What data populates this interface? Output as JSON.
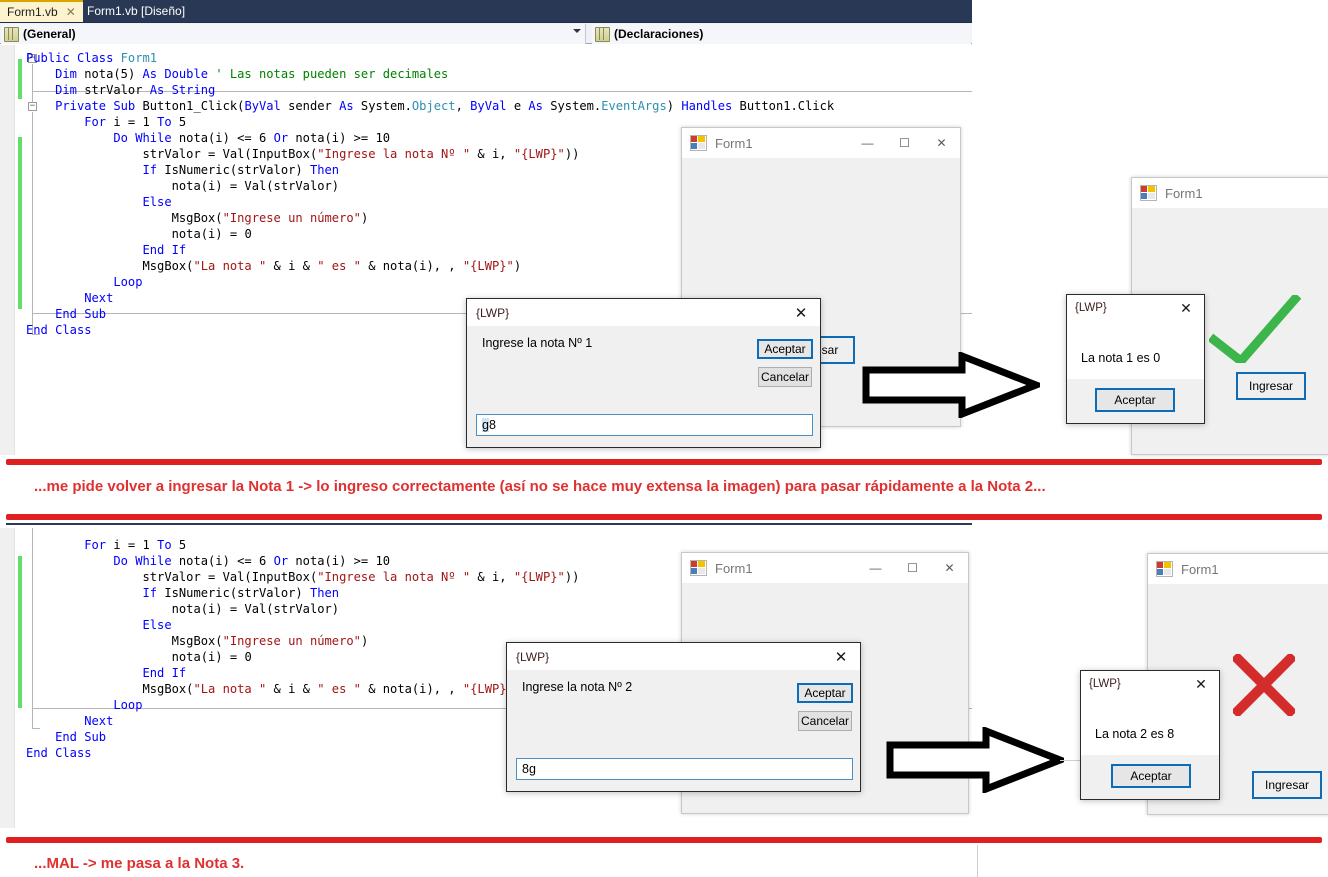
{
  "ide": {
    "tabs": [
      {
        "label": "Form1.vb",
        "active": true,
        "close_glyph": "✕"
      },
      {
        "label": "Form1.vb [Diseño]",
        "active": false
      }
    ],
    "nav": {
      "scope": "(General)",
      "member": "(Declaraciones)",
      "dropdown_glyph": "▼"
    },
    "code_top": [
      "Public Class Form1",
      "    Dim nota(5) As Double ' Las notas pueden ser decimales",
      "    Dim strValor As String",
      "    Private Sub Button1_Click(ByVal sender As System.Object, ByVal e As System.EventArgs) Handles Button1.Click",
      "        For i = 1 To 5",
      "            Do While nota(i) <= 6 Or nota(i) >= 10",
      "                strValor = Val(InputBox(\"Ingrese la nota Nº \" & i, \"{LWP}\"))",
      "                If IsNumeric(strValor) Then",
      "                    nota(i) = Val(strValor)",
      "                Else",
      "                    MsgBox(\"Ingrese un número\")",
      "                    nota(i) = 0",
      "                End If",
      "                MsgBox(\"La nota \" & i & \" es \" & nota(i), , \"{LWP}\")",
      "            Loop",
      "        Next",
      "    End Sub",
      "End Class"
    ],
    "code_bottom": [
      "        For i = 1 To 5",
      "            Do While nota(i) <= 6 Or nota(i) >= 10",
      "                strValor = Val(InputBox(\"Ingrese la nota Nº \" & i, \"{LWP}\"))",
      "                If IsNumeric(strValor) Then",
      "                    nota(i) = Val(strValor)",
      "                Else",
      "                    MsgBox(\"Ingrese un número\")",
      "                    nota(i) = 0",
      "                End If",
      "                MsgBox(\"La nota \" & i & \" es \" & nota(i), , \"{LWP}\")",
      "            Loop",
      "        Next",
      "    End Sub",
      "End Class"
    ]
  },
  "section_top": {
    "form_window": {
      "title": "Form1",
      "minimize_glyph": "—",
      "maximize_glyph": "☐",
      "close_glyph": "✕",
      "button_label": "sar"
    },
    "inputbox": {
      "title": "{LWP}",
      "close_glyph": "✕",
      "prompt": "Ingrese la nota Nº 1",
      "accept_label": "Aceptar",
      "cancel_label": "Cancelar",
      "value_selected": "g",
      "value_rest": "8"
    },
    "result_form": {
      "title": "Form1",
      "minimize_glyph": "—",
      "button_label": "Ingresar"
    },
    "msgbox": {
      "title": "{LWP}",
      "close_glyph": "✕",
      "message": "La nota 1 es 0",
      "accept_label": "Aceptar"
    },
    "verdict": "check"
  },
  "section_bottom": {
    "form_window": {
      "title": "Form1",
      "minimize_glyph": "—",
      "maximize_glyph": "☐",
      "close_glyph": "✕"
    },
    "inputbox": {
      "title": "{LWP}",
      "close_glyph": "✕",
      "prompt": "Ingrese la nota Nº 2",
      "accept_label": "Aceptar",
      "cancel_label": "Cancelar",
      "value": "8g"
    },
    "result_form": {
      "title": "Form1",
      "minimize_glyph": "—",
      "button_label": "Ingresar"
    },
    "msgbox": {
      "title": "{LWP}",
      "close_glyph": "✕",
      "message": "La nota 2 es 8",
      "accept_label": "Aceptar"
    },
    "verdict": "cross"
  },
  "captions": {
    "middle": "...me pide volver a ingresar la Nota 1 -> lo ingreso correctamente (así no se hace muy extensa la imagen) para pasar rápidamente a la Nota 2...",
    "bottom": "...MAL -> me pasa a la Nota 3."
  },
  "colors": {
    "accent_blue": "#0d6cb5",
    "annotation_red": "#e03131",
    "divider_red": "#e02020",
    "check_green": "#3cb54a",
    "cross_red": "#d42b2b",
    "tab_bar": "#293955",
    "active_tab": "#fdf3ce",
    "change_bar_green": "#64dd6a"
  }
}
